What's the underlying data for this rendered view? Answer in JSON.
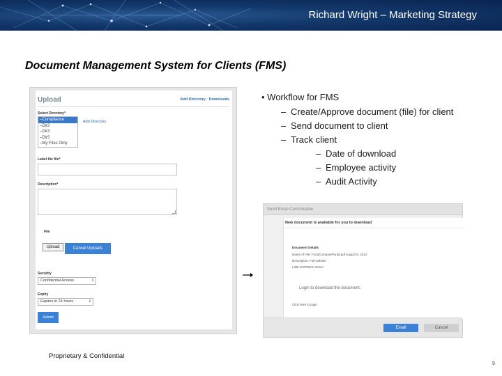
{
  "header": {
    "title": "Richard Wright – Marketing Strategy"
  },
  "slide": {
    "title": "Document Management System for Clients (FMS)"
  },
  "upload_form": {
    "title": "Upload",
    "links": "Add Directory · Downloads",
    "select_directory_label": "Select Directory*",
    "directories": [
      "–Compliance",
      "–Dir2",
      "–Dir3",
      "–Dir5",
      "–My Files Only"
    ],
    "add_directory_link": "Add Directory",
    "label_file_label": "Label the file*",
    "description_label": "Description*",
    "file_label": "File",
    "upload_button": "Upload",
    "cancel_uploads_button": "Cancel Uploads",
    "security_label": "Security",
    "security_value": "Confidential Access",
    "expiry_label": "Expiry",
    "expiry_value": "Expires in 24 hours",
    "submit_button": "Submit"
  },
  "bullets": {
    "main": "Workflow for FMS",
    "level2": [
      "Create/Approve document (file) for client",
      "Send document to client",
      "Track client"
    ],
    "level3": [
      "Date of download",
      "Employee activity",
      "Audit Activity"
    ]
  },
  "email_confirmation": {
    "header": "Send Email Confirmation",
    "subject": "New document is available for you to download",
    "details_label": "Document Details",
    "details_line1": "Name of File: FundComparePortal.pdf August 8, 2012",
    "details_line2": "Description: Full website",
    "details_line3": "LINK EXPIRES: Never",
    "login_text": "Login to download the document.",
    "click_here": "Click here to login",
    "email_button": "Email",
    "cancel_button": "Cancel"
  },
  "footer": {
    "confidential": "Proprietary & Confidential",
    "page_number": "9"
  },
  "colors": {
    "banner": "#12386b",
    "accent_blue": "#3b82d6",
    "link_blue": "#2b6cb0"
  }
}
